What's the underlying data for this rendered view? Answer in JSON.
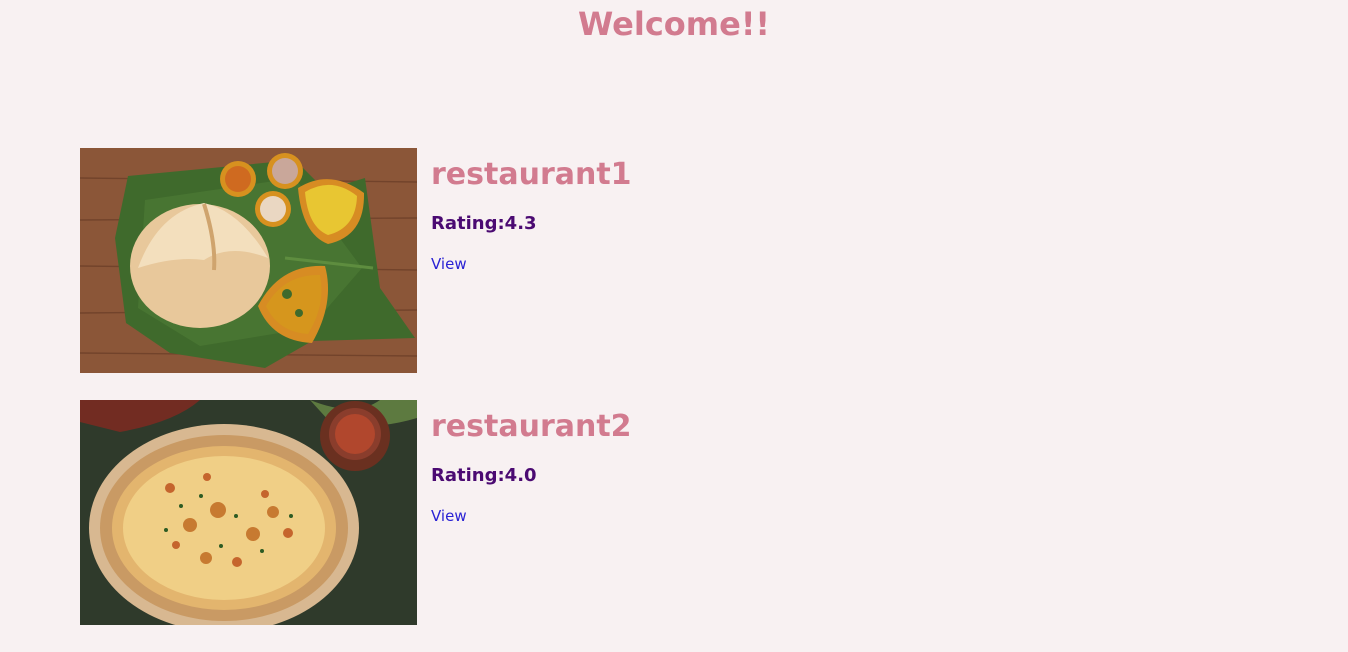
{
  "page": {
    "title": "Welcome!!"
  },
  "restaurants": [
    {
      "name": "restaurant1",
      "rating_label": "Rating:4.3",
      "link_label": "View",
      "image": "south-indian-dosa-thali"
    },
    {
      "name": "restaurant2",
      "rating_label": "Rating:4.0",
      "link_label": "View",
      "image": "pizza"
    }
  ],
  "colors": {
    "background": "#f8f1f2",
    "title": "#d27b8f",
    "rating": "#4b0a72",
    "link": "#2a22d4"
  }
}
